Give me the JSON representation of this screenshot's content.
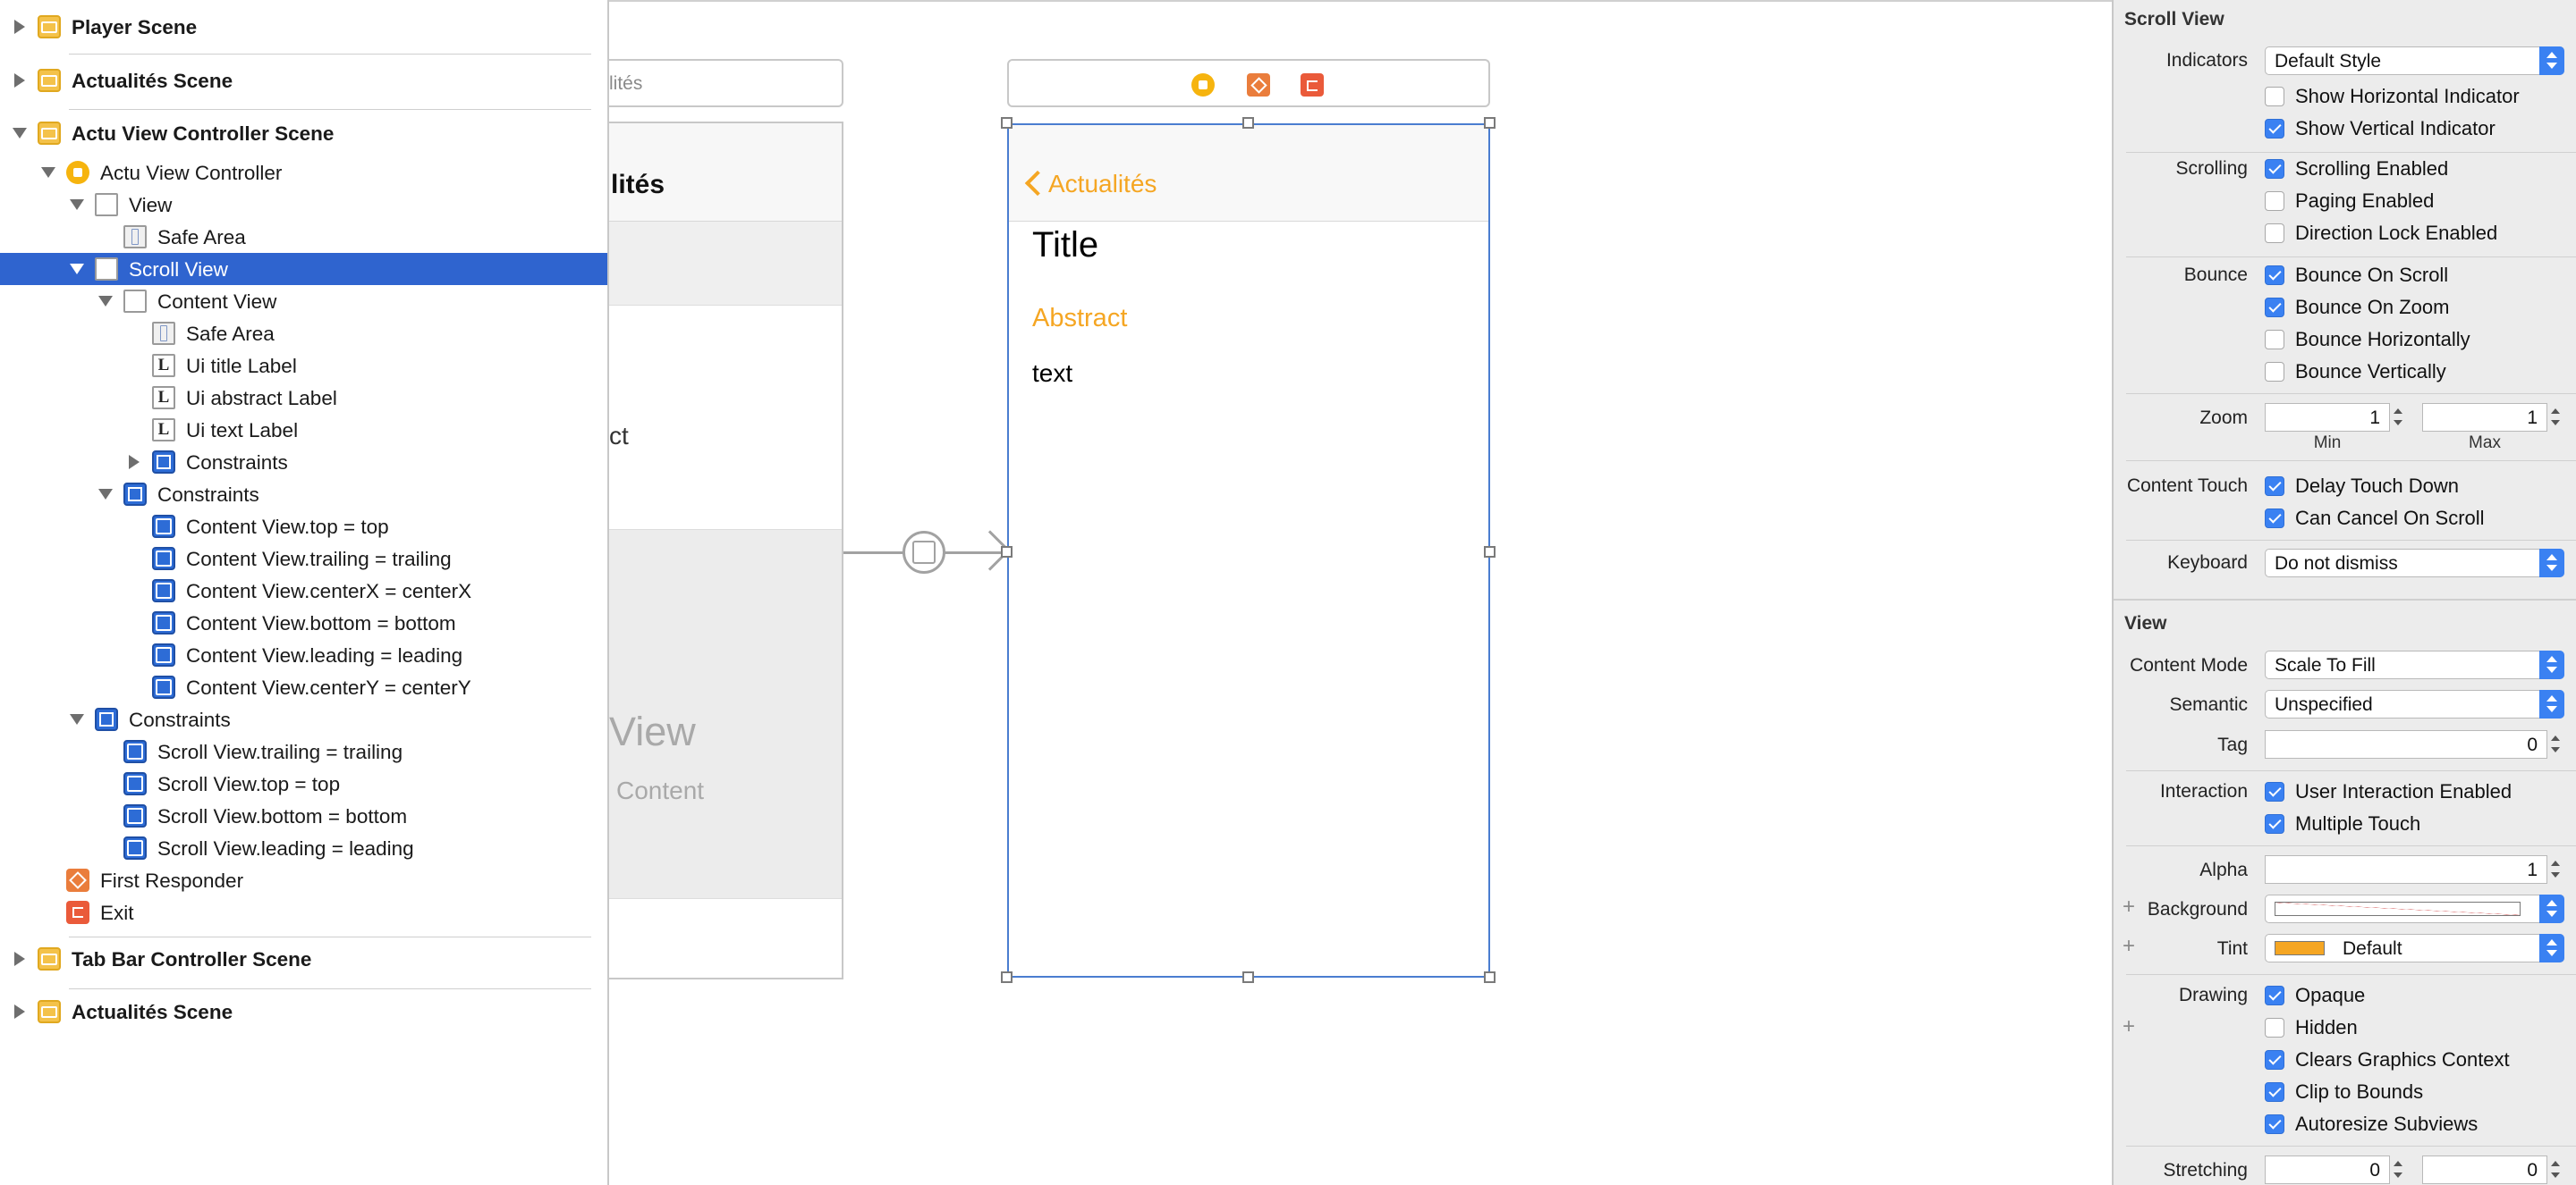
{
  "outline": {
    "items": [
      {
        "label": "Player Scene",
        "icon": "scene-icon",
        "disclosure": "closed"
      },
      {
        "label": "Actualités Scene",
        "icon": "scene-icon",
        "disclosure": "closed"
      },
      {
        "label": "Actu View Controller Scene",
        "icon": "scene-icon",
        "disclosure": "open"
      },
      {
        "label": "Actu View Controller",
        "icon": "view-controller-icon",
        "disclosure": "open"
      },
      {
        "label": "View",
        "icon": "view-icon",
        "disclosure": "open"
      },
      {
        "label": "Safe Area",
        "icon": "safe-area-icon",
        "disclosure": "none"
      },
      {
        "label": "Scroll View",
        "icon": "view-icon",
        "disclosure": "open",
        "selected": true
      },
      {
        "label": "Content View",
        "icon": "view-icon",
        "disclosure": "open"
      },
      {
        "label": "Safe Area",
        "icon": "safe-area-icon",
        "disclosure": "none"
      },
      {
        "label": "Ui title Label",
        "icon": "label-icon",
        "disclosure": "none"
      },
      {
        "label": "Ui abstract Label",
        "icon": "label-icon",
        "disclosure": "none"
      },
      {
        "label": "Ui text Label",
        "icon": "label-icon",
        "disclosure": "none"
      },
      {
        "label": "Constraints",
        "icon": "constraints-icon",
        "disclosure": "closed"
      },
      {
        "label": "Constraints",
        "icon": "constraints-icon",
        "disclosure": "open"
      },
      {
        "label": "Content View.top = top",
        "icon": "constraint-icon",
        "disclosure": "none"
      },
      {
        "label": "Content View.trailing = trailing",
        "icon": "constraint-icon",
        "disclosure": "none"
      },
      {
        "label": "Content View.centerX = centerX",
        "icon": "constraint-icon",
        "disclosure": "none"
      },
      {
        "label": "Content View.bottom = bottom",
        "icon": "constraint-icon",
        "disclosure": "none"
      },
      {
        "label": "Content View.leading = leading",
        "icon": "constraint-icon",
        "disclosure": "none"
      },
      {
        "label": "Content View.centerY = centerY",
        "icon": "constraint-icon",
        "disclosure": "none"
      },
      {
        "label": "Constraints",
        "icon": "constraints-icon",
        "disclosure": "open"
      },
      {
        "label": "Scroll View.trailing = trailing",
        "icon": "constraint-icon",
        "disclosure": "none"
      },
      {
        "label": "Scroll View.top = top",
        "icon": "constraint-icon",
        "disclosure": "none"
      },
      {
        "label": "Scroll View.bottom = bottom",
        "icon": "constraint-icon",
        "disclosure": "none"
      },
      {
        "label": "Scroll View.leading = leading",
        "icon": "constraint-icon",
        "disclosure": "none"
      },
      {
        "label": "First Responder",
        "icon": "first-responder-icon",
        "disclosure": "none"
      },
      {
        "label": "Exit",
        "icon": "exit-icon",
        "disclosure": "none"
      },
      {
        "label": "Tab Bar Controller Scene",
        "icon": "scene-icon",
        "disclosure": "closed"
      },
      {
        "label": "Actualités Scene",
        "icon": "scene-icon",
        "disclosure": "closed"
      }
    ]
  },
  "canvas": {
    "prev_scene": {
      "bar_title": "lités",
      "nav_title": "lités",
      "body_text": "ct",
      "placeholder_title": "View",
      "placeholder_subtitle": "Content"
    },
    "device": {
      "back_label": "Actualités",
      "title": "Title",
      "abstract": "Abstract",
      "text": "text"
    },
    "accent_color": "#f5a623",
    "selection_color": "#4a7dd0"
  },
  "inspector": {
    "scroll_view": {
      "section_title": "Scroll View",
      "indicators_label": "Indicators",
      "indicators_value": "Default Style",
      "show_horizontal": {
        "label": "Show Horizontal Indicator",
        "checked": false
      },
      "show_vertical": {
        "label": "Show Vertical Indicator",
        "checked": true
      },
      "scrolling_label": "Scrolling",
      "scrolling_enabled": {
        "label": "Scrolling Enabled",
        "checked": true
      },
      "paging_enabled": {
        "label": "Paging Enabled",
        "checked": false
      },
      "direction_lock": {
        "label": "Direction Lock Enabled",
        "checked": false
      },
      "bounce_label": "Bounce",
      "bounce_on_scroll": {
        "label": "Bounce On Scroll",
        "checked": true
      },
      "bounce_on_zoom": {
        "label": "Bounce On Zoom",
        "checked": true
      },
      "bounce_horizontally": {
        "label": "Bounce Horizontally",
        "checked": false
      },
      "bounce_vertically": {
        "label": "Bounce Vertically",
        "checked": false
      },
      "zoom_label": "Zoom",
      "zoom_min": "1",
      "zoom_max": "1",
      "zoom_min_caption": "Min",
      "zoom_max_caption": "Max",
      "content_touch_label": "Content Touch",
      "delay_touch_down": {
        "label": "Delay Touch Down",
        "checked": true
      },
      "can_cancel_on_scroll": {
        "label": "Can Cancel On Scroll",
        "checked": true
      },
      "keyboard_label": "Keyboard",
      "keyboard_value": "Do not dismiss"
    },
    "view": {
      "section_title": "View",
      "content_mode_label": "Content Mode",
      "content_mode_value": "Scale To Fill",
      "semantic_label": "Semantic",
      "semantic_value": "Unspecified",
      "tag_label": "Tag",
      "tag_value": "0",
      "interaction_label": "Interaction",
      "user_interaction_enabled": {
        "label": "User Interaction Enabled",
        "checked": true
      },
      "multiple_touch": {
        "label": "Multiple Touch",
        "checked": true
      },
      "alpha_label": "Alpha",
      "alpha_value": "1",
      "background_label": "Background",
      "tint_label": "Tint",
      "tint_value": "Default",
      "tint_color": "#f5a623",
      "drawing_label": "Drawing",
      "opaque": {
        "label": "Opaque",
        "checked": true
      },
      "hidden": {
        "label": "Hidden",
        "checked": false
      },
      "clears_graphics_context": {
        "label": "Clears Graphics Context",
        "checked": true
      },
      "clip_to_bounds": {
        "label": "Clip to Bounds",
        "checked": true
      },
      "autoresize_subviews": {
        "label": "Autoresize Subviews",
        "checked": true
      },
      "stretching_label": "Stretching",
      "stretching_x": "0",
      "stretching_y": "0"
    },
    "accent_color": "#3a81f2"
  }
}
